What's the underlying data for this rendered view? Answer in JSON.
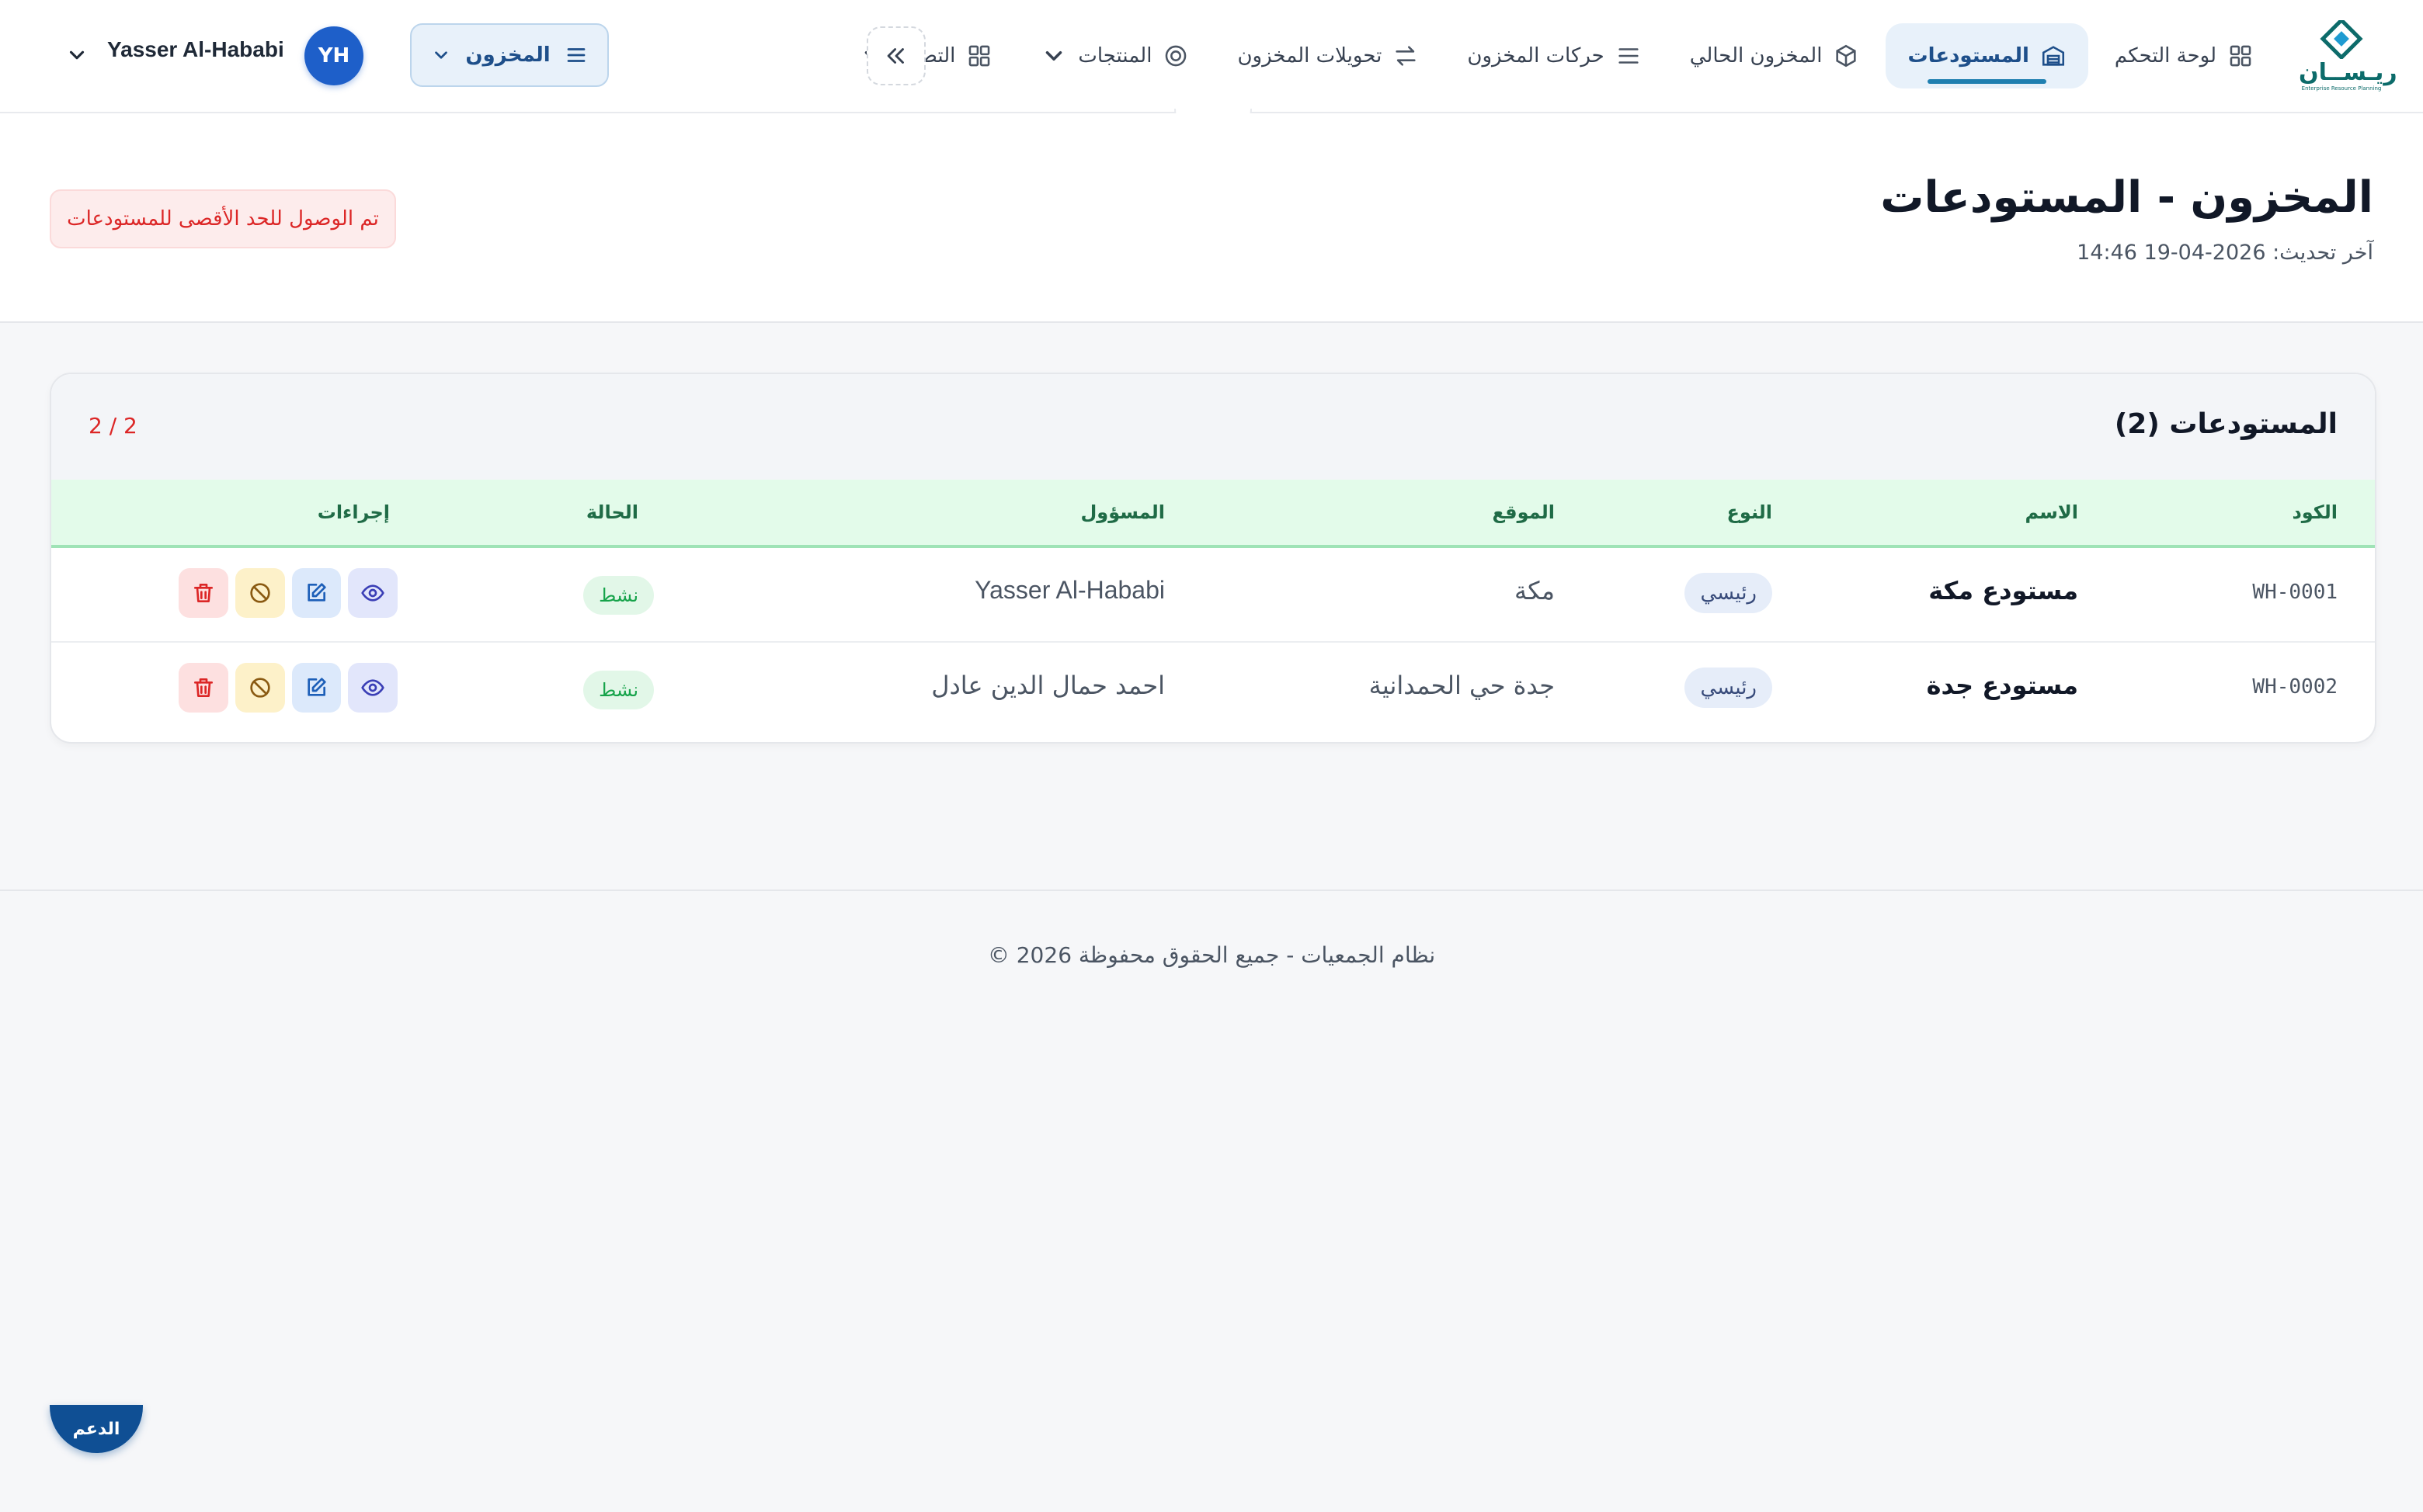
{
  "brand": {
    "logo_text": "ريـســان",
    "logo_subtitle": "Enterprise Resource Planning"
  },
  "nav": {
    "items": [
      {
        "label": "لوحة التحكم",
        "icon": "grid-icon",
        "active": false
      },
      {
        "label": "المستودعات",
        "icon": "warehouse-icon",
        "active": true
      },
      {
        "label": "المخزون الحالي",
        "icon": "box-icon",
        "active": false
      },
      {
        "label": "حركات المخزون",
        "icon": "list-icon",
        "active": false
      },
      {
        "label": "تحويلات المخزون",
        "icon": "transfer-arrows-icon",
        "active": false
      },
      {
        "label": "المنتجات",
        "icon": "target-icon",
        "active": false,
        "dropdown": true
      },
      {
        "label": "التصنيع",
        "icon": "grid-icon",
        "active": false,
        "dropdown": true
      }
    ],
    "module_button": "المخزون",
    "user": {
      "initials": "YH",
      "name": "Yasser Al-Hababi"
    }
  },
  "header": {
    "title": "المخزون - المستودعات",
    "last_update": "آخر تحديث: 2026-04-19 14:46",
    "limit_alert": "تم الوصول للحد الأقصى للمستودعات"
  },
  "table": {
    "title": "المستودعات (2)",
    "count": "2 / 2",
    "columns": {
      "code": "الكود",
      "name": "الاسم",
      "type": "النوع",
      "location": "الموقع",
      "manager": "المسؤول",
      "status": "الحالة",
      "actions": "إجراءات"
    },
    "rows": [
      {
        "code": "WH-0001",
        "name": "مستودع مكة",
        "type": "رئيسي",
        "location": "مكة",
        "manager": "Yasser Al-Hababi",
        "status": "نشط"
      },
      {
        "code": "WH-0002",
        "name": "مستودع جدة",
        "type": "رئيسي",
        "location": "جدة حي الحمدانية",
        "manager": "احمد حمال الدين عادل",
        "status": "نشط"
      }
    ]
  },
  "footer": {
    "text": "© 2026 نظام الجمعيات - جميع الحقوق محفوظة"
  },
  "support": {
    "label": "الدعم"
  },
  "colors": {
    "primary": "#1e5fc9",
    "active_nav_bg": "#e8f1fa",
    "table_header_bg": "#e3fbea",
    "alert_red": "#dc2626",
    "status_green": "#16a34a"
  }
}
